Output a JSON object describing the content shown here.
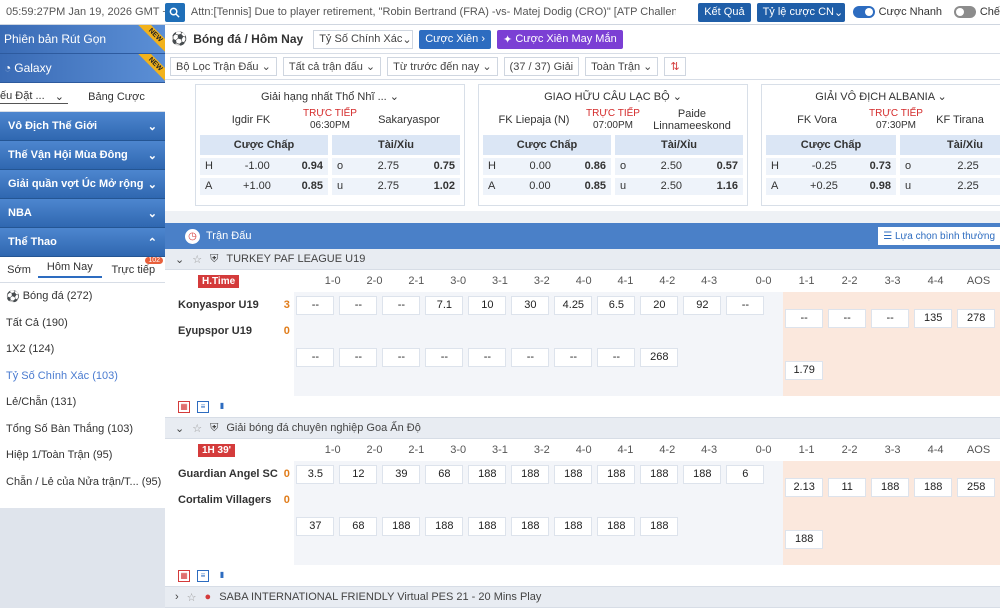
{
  "topbar": {
    "time": "05:59:27PM Jan 19, 2026 GMT +7",
    "marquee": "Attn:[Tennis] Due to player retirement, \"Robin Bertrand (FRA) -vs- Matej Dodig (CRO)\" [ATP Challenger -",
    "result_btn": "Kết Quả",
    "odds_type": "Tỷ lệ cược CN",
    "quick_bet": "Cược Nhanh",
    "mode_label": "Chế"
  },
  "sidebar": {
    "banners": [
      "Phiên bản Rút Gọn",
      "Galaxy"
    ],
    "banner_tag": "NEW",
    "tabs": [
      "ếu Đặt ...",
      "Bảng Cược"
    ],
    "sections": [
      "Vô Địch Thế Giới",
      "Thế Vận Hội Mùa Đông",
      "Giải quần vợt Úc Mở rộng",
      "NBA",
      "Thể Thao"
    ],
    "subtabs": [
      "Sớm",
      "Hôm Nay",
      "Trực tiếp"
    ],
    "live_badge": "102",
    "menu": [
      {
        "label": "Bóng đá",
        "count": "(272)"
      },
      {
        "label": "Tất Cả",
        "count": "(190)"
      },
      {
        "label": "1X2",
        "count": "(124)"
      },
      {
        "label": "Tỷ Số Chính Xác",
        "count": "(103)"
      },
      {
        "label": "Lẻ/Chẵn",
        "count": "(131)"
      },
      {
        "label": "Tổng Số Bàn Thắng",
        "count": "(103)"
      },
      {
        "label": "Hiệp 1/Toàn Trận",
        "count": "(95)"
      },
      {
        "label": "Chẵn / Lẻ của Nửa trận/T...",
        "count": "(95)"
      }
    ]
  },
  "main": {
    "breadcrumb": "Bóng đá / Hôm Nay",
    "market": "Tỷ Số Chính Xác",
    "parlay_btn": "Cược Xiên",
    "lucky_btn": "Cược Xiên May Mắn",
    "filters": [
      "Bộ Lọc Trận Đấu",
      "Tất cả trận đấu",
      "Từ trước đến nay",
      "(37 / 37) Giải",
      "Toàn Trận"
    ],
    "cards": [
      {
        "league": "Giải hạng nhất Thổ Nhĩ ...",
        "home": "Igdir FK",
        "away": "Sakaryaspor",
        "live": "TRỰC TIẾP",
        "time": "06:30PM",
        "h1": "Cược Chấp",
        "h2": "Tài/Xỉu",
        "r1": [
          "H",
          "-1.00",
          "0.94",
          "o",
          "2.75",
          "0.75"
        ],
        "r2": [
          "A",
          "+1.00",
          "0.85",
          "u",
          "2.75",
          "1.02"
        ]
      },
      {
        "league": "GIAO HỮU CÂU LẠC BỘ",
        "home": "FK Liepaja (N)",
        "away": "Paide Linnameeskond",
        "live": "TRỰC TIẾP",
        "time": "07:00PM",
        "h1": "Cược Chấp",
        "h2": "Tài/Xỉu",
        "r1": [
          "H",
          "0.00",
          "0.86",
          "o",
          "2.50",
          "0.57"
        ],
        "r2": [
          "A",
          "0.00",
          "0.85",
          "u",
          "2.50",
          "1.16"
        ]
      },
      {
        "league": "GIẢI VÔ ĐỊCH ALBANIA",
        "home": "FK Vora",
        "away": "KF Tirana",
        "live": "TRỰC TIẾP",
        "time": "07:30PM",
        "h1": "Cược Chấp",
        "h2": "Tài/Xỉu",
        "r1": [
          "H",
          "-0.25",
          "0.73",
          "o",
          "2.25",
          ""
        ],
        "r2": [
          "A",
          "+0.25",
          "0.98",
          "u",
          "2.25",
          ""
        ]
      }
    ],
    "list_title": "Trận Đấu",
    "sort_label": "Lựa chọn bình thường",
    "score_headers": [
      "1-0",
      "2-0",
      "2-1",
      "3-0",
      "3-1",
      "3-2",
      "4-0",
      "4-1",
      "4-2",
      "4-3"
    ],
    "score_headers2": [
      "0-0",
      "1-1",
      "2-2",
      "3-3",
      "4-4",
      "AOS"
    ],
    "leagues": [
      {
        "name": "TURKEY PAF LEAGUE U19",
        "status": "H.Time",
        "home": "Konyaspor U19",
        "home_score": "3",
        "away": "Eyupspor U19",
        "away_score": "0",
        "odds_home": [
          "--",
          "--",
          "--",
          "7.1",
          "10",
          "30",
          "4.25",
          "6.5",
          "20",
          "92"
        ],
        "odds_away": [
          "--",
          "--",
          "--",
          "--",
          "--",
          "--",
          "--",
          "--",
          "--",
          "268"
        ],
        "odds_draw": [
          "--",
          "--",
          "--",
          "135",
          "278",
          "1.79"
        ]
      },
      {
        "name": "Giải bóng đá chuyên nghiệp Goa Ấn Độ",
        "status": "1H 39'",
        "home": "Guardian Angel SC",
        "home_score": "0",
        "away": "Cortalim Villagers",
        "away_score": "0",
        "odds_home": [
          "3.5",
          "12",
          "39",
          "68",
          "188",
          "188",
          "188",
          "188",
          "188",
          "188"
        ],
        "odds_away": [
          "6",
          "37",
          "68",
          "188",
          "188",
          "188",
          "188",
          "188",
          "188",
          "188"
        ],
        "odds_draw": [
          "2.13",
          "11",
          "188",
          "188",
          "258",
          "188"
        ]
      },
      {
        "name": "SABA INTERNATIONAL FRIENDLY Virtual PES 21 - 20 Mins Play"
      }
    ]
  }
}
